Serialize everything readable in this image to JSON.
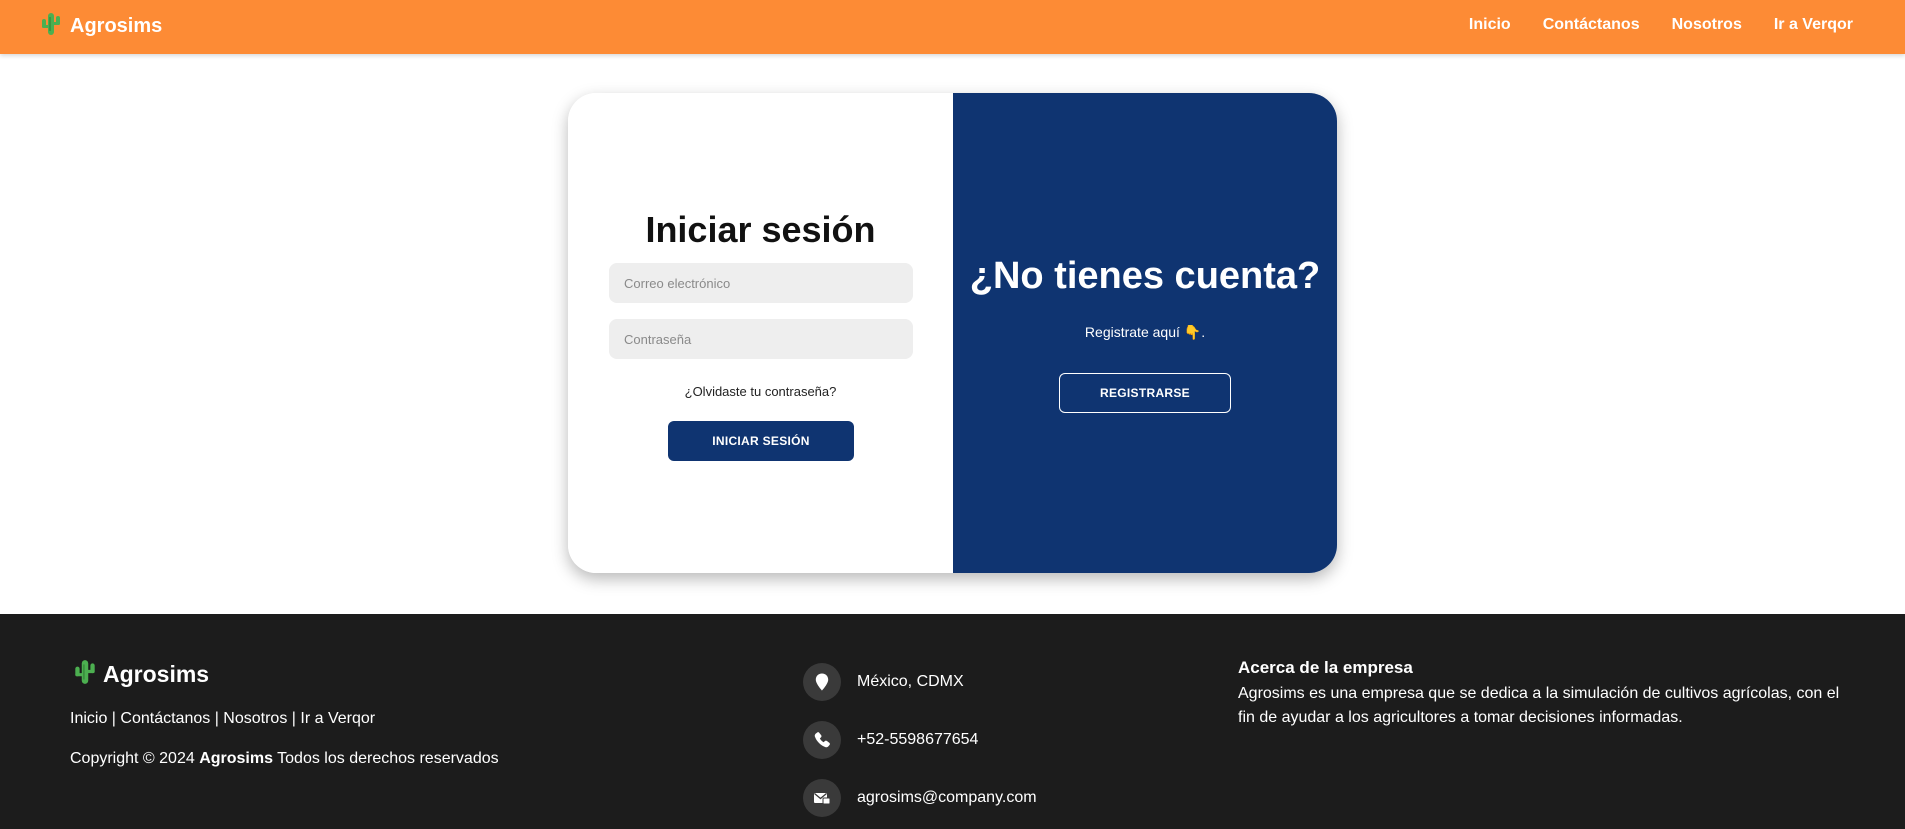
{
  "nav": {
    "brand": "Agrosims",
    "links": [
      "Inicio",
      "Contáctanos",
      "Nosotros",
      "Ir a Verqor"
    ]
  },
  "login": {
    "title": "Iniciar sesión",
    "email_placeholder": "Correo electrónico",
    "password_placeholder": "Contraseña",
    "forgot": "¿Olvidaste tu contraseña?",
    "button": "INICIAR SESIÓN"
  },
  "signup": {
    "title": "¿No tienes cuenta?",
    "text": "Registrate aquí 👇.",
    "button": "REGISTRARSE"
  },
  "footer": {
    "brand": "Agrosims",
    "links": [
      "Inicio",
      "Contáctanos",
      "Nosotros",
      "Ir a Verqor"
    ],
    "separator": " | ",
    "copyright_prefix": "Copyright © 2024 ",
    "copyright_brand": "Agrosims",
    "copyright_suffix": " Todos los derechos reservados",
    "contact": {
      "location": "México, CDMX",
      "phone": "+52-5598677654",
      "email": "agrosims@company.com"
    },
    "about_title": "Acerca de la empresa",
    "about_text": "Agrosims es una empresa que se dedica a la simulación de cultivos agrícolas, con el fin de ayudar a los agricultores a tomar decisiones informadas."
  },
  "colors": {
    "nav_bg": "#fd8b35",
    "primary": "#0f3471",
    "footer_bg": "#1c1c1c",
    "cactus": "#4caf50"
  },
  "icons": {
    "brand": "cactus-icon",
    "location": "map-pin-icon",
    "phone": "phone-icon",
    "email": "envelope-icon"
  }
}
